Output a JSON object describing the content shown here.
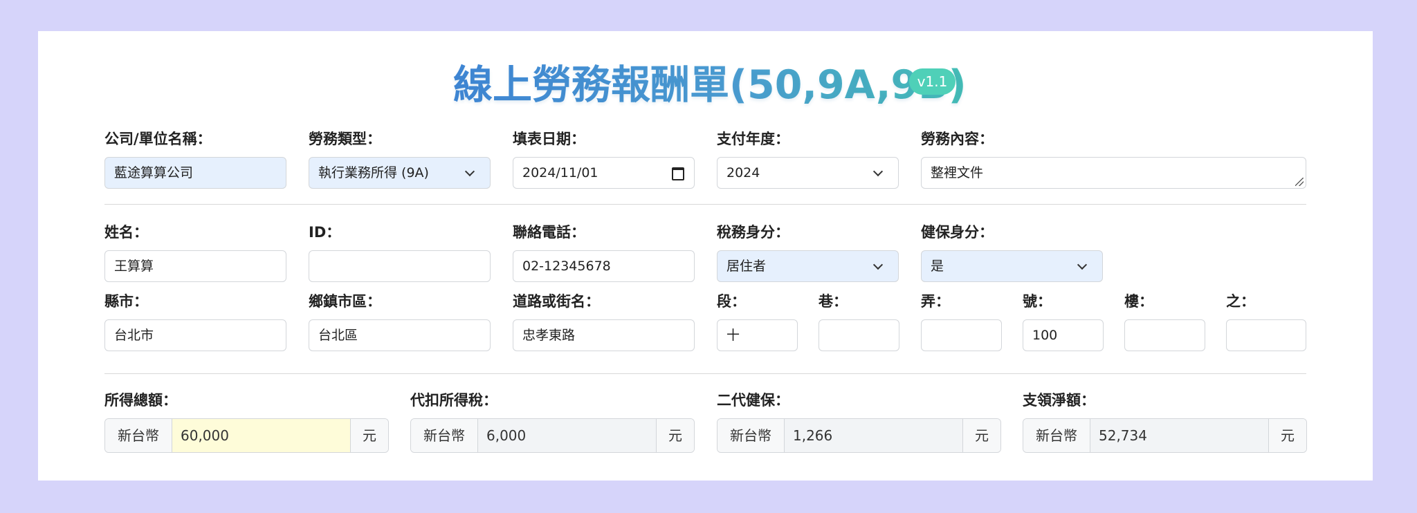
{
  "header": {
    "title": "線上勞務報酬單(50,9A,9B)",
    "version": "v1.1"
  },
  "row1": {
    "company": {
      "label": "公司/單位名稱：",
      "value": "藍途算算公司"
    },
    "service_type": {
      "label": "勞務類型：",
      "value": "執行業務所得 (9A)"
    },
    "fill_date": {
      "label": "填表日期：",
      "value": "2024/11/01"
    },
    "pay_year": {
      "label": "支付年度：",
      "value": "2024"
    },
    "service_content": {
      "label": "勞務內容：",
      "value": "整裡文件"
    }
  },
  "row2": {
    "name": {
      "label": "姓名：",
      "value": "王算算"
    },
    "id": {
      "label": "ID：",
      "value": ""
    },
    "phone": {
      "label": "聯絡電話：",
      "value": "02-12345678"
    },
    "tax_status": {
      "label": "稅務身分：",
      "value": "居住者"
    },
    "insurance_status": {
      "label": "健保身分：",
      "value": "是"
    }
  },
  "row3": {
    "county": {
      "label": "縣市：",
      "value": "台北市"
    },
    "district": {
      "label": "鄉鎮市區：",
      "value": "台北區"
    },
    "road": {
      "label": "道路或街名：",
      "value": "忠孝東路"
    },
    "section": {
      "label": "段：",
      "value": "十"
    },
    "lane": {
      "label": "巷：",
      "value": ""
    },
    "alley": {
      "label": "弄：",
      "value": ""
    },
    "number": {
      "label": "號：",
      "value": "100"
    },
    "floor": {
      "label": "樓：",
      "value": ""
    },
    "of": {
      "label": "之：",
      "value": ""
    }
  },
  "amounts": {
    "currency": "新台幣",
    "unit": "元",
    "gross": {
      "label": "所得總額：",
      "value": "60,000"
    },
    "withholding_tax": {
      "label": "代扣所得稅：",
      "value": "6,000"
    },
    "nhi_supplement": {
      "label": "二代健保：",
      "value": "1,266"
    },
    "net": {
      "label": "支領淨額：",
      "value": "52,734"
    }
  },
  "colors": {
    "page_background": "#d6d4fa",
    "title_gradient_start": "#3f86d6",
    "title_gradient_end": "#45c2b6",
    "version_badge": "#4fd0b8",
    "select_background": "#e6f0fd",
    "highlight_input": "#fefcd9"
  },
  "icons": {
    "select": "chevron-down-icon",
    "date": "calendar-icon",
    "textarea": "resize-handle-icon"
  }
}
